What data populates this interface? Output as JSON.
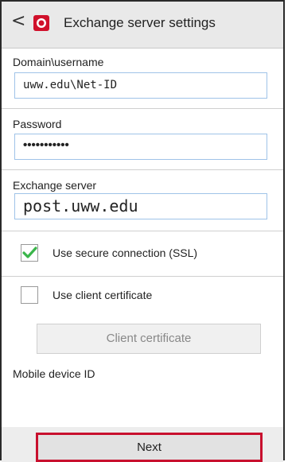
{
  "header": {
    "back_glyph": "<",
    "icon": "red-target-icon",
    "title": "Exchange server settings"
  },
  "domain": {
    "label": "Domain\\username",
    "value": "uww.edu\\Net-ID"
  },
  "password": {
    "label": "Password",
    "value": "•••••••••••"
  },
  "server": {
    "label": "Exchange server",
    "value": "post.uww.edu"
  },
  "ssl": {
    "label": "Use secure connection (SSL)",
    "checked": true
  },
  "client_cert_option": {
    "label": "Use client certificate",
    "checked": false
  },
  "client_cert_button": {
    "label": "Client certificate"
  },
  "mobile_id": {
    "label": "Mobile device ID"
  },
  "next_button": {
    "label": "Next"
  },
  "colors": {
    "accent_check": "#3ab54a",
    "highlight": "#c8102e",
    "input_border": "#9fc3e8"
  }
}
